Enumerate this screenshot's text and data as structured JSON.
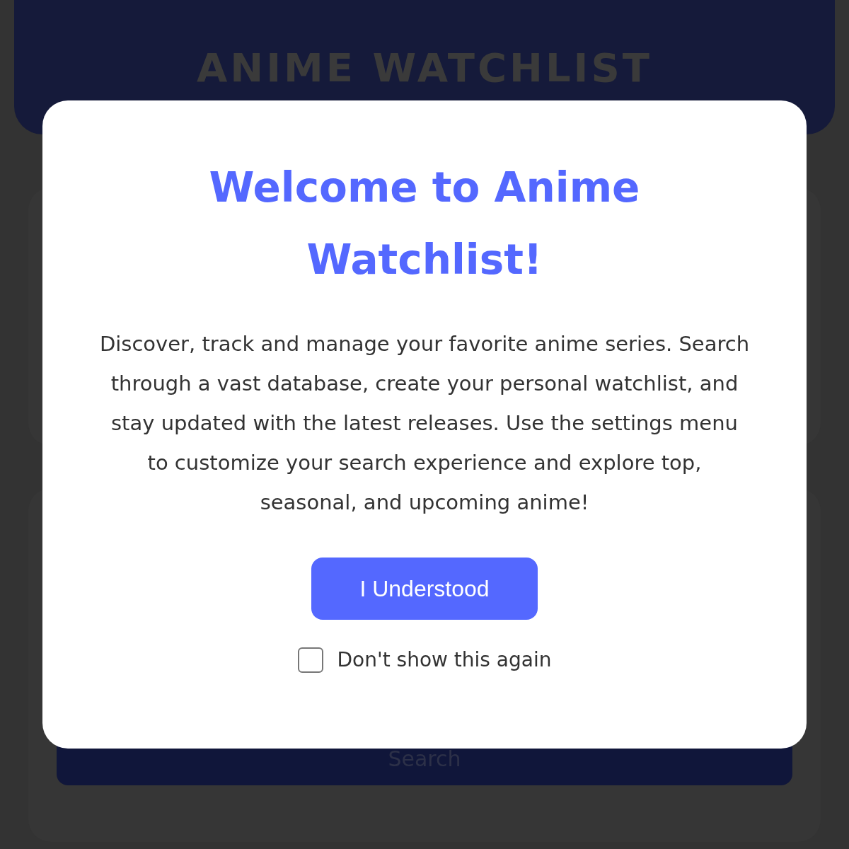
{
  "header": {
    "title": "ANIME WATCHLIST"
  },
  "search_card": {
    "button": "Search"
  },
  "dialog": {
    "title": "Welcome to Anime Watchlist!",
    "body": "Discover, track and manage your favorite anime series. Search through a vast database, create your personal watchlist, and stay updated with the latest releases. Use the settings menu to customize your search experience and explore top, seasonal, and upcoming anime!",
    "button": "I Understood",
    "checkbox": {
      "label": "Don't show this again",
      "checked": false
    }
  }
}
